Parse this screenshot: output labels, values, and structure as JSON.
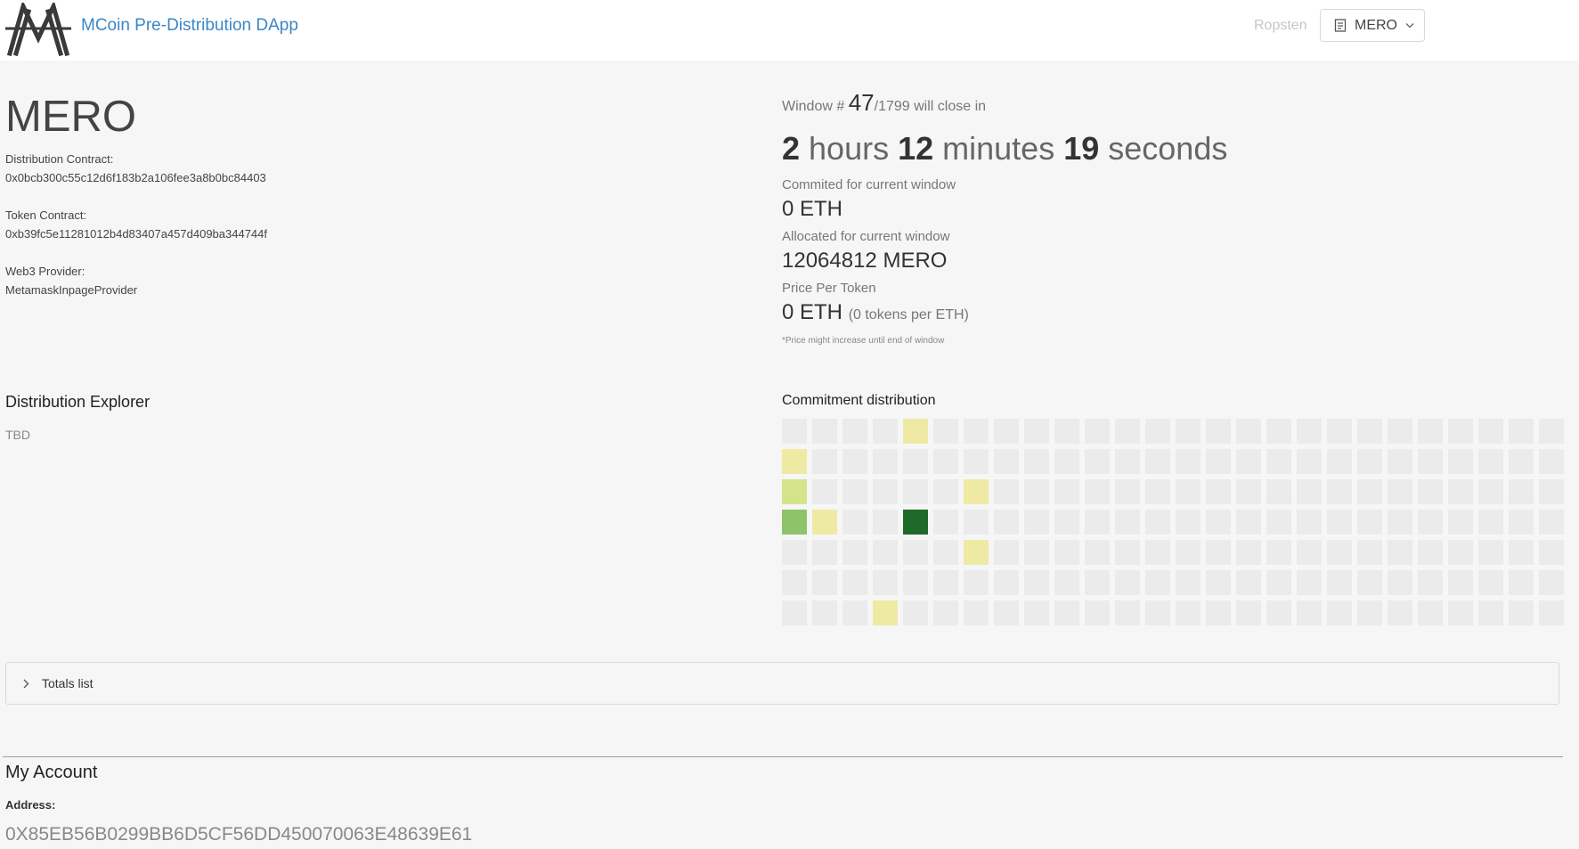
{
  "header": {
    "app_title": "MCoin Pre-Distribution DApp",
    "network": "Ropsten",
    "token_select": {
      "value": "MERO",
      "icon": "document-icon",
      "chevron_icon": "chevron-down-icon"
    },
    "logo_icon": "mcoin-logo-icon"
  },
  "token": {
    "name": "MERO",
    "distribution_contract_label": "Distribution Contract:",
    "distribution_contract": "0x0bcb300c55c12d6f183b2a106fee3a8b0bc84403",
    "token_contract_label": "Token Contract:",
    "token_contract": "0xb39fc5e11281012b4d83407a457d409ba344744f",
    "web3_provider_label": "Web3 Provider:",
    "web3_provider": "MetamaskInpageProvider"
  },
  "window": {
    "prefix": "Window # ",
    "current": "47",
    "total": "/1799",
    "suffix": " will close in",
    "countdown": {
      "hours": "2",
      "hours_label": " hours ",
      "minutes": "12",
      "minutes_label": " minutes ",
      "seconds": "19",
      "seconds_label": " seconds"
    },
    "committed_label": "Commited for current window",
    "committed_value": "0 ETH",
    "allocated_label": "Allocated for current window",
    "allocated_value": "12064812 MERO",
    "price_label": "Price Per Token",
    "price_value": "0 ETH",
    "price_rate": "(0 tokens per ETH)",
    "price_note": "*Price might increase until end of window"
  },
  "explorer": {
    "title": "Distribution Explorer",
    "content": "TBD"
  },
  "commitment": {
    "title": "Commitment distribution",
    "rows": 7,
    "cols": 26,
    "base_color": "#ebebeb",
    "highlighted": [
      {
        "row": 0,
        "col": 4,
        "color": "#eeeaa3"
      },
      {
        "row": 1,
        "col": 0,
        "color": "#eeeaa3"
      },
      {
        "row": 2,
        "col": 0,
        "color": "#d5e38a"
      },
      {
        "row": 2,
        "col": 6,
        "color": "#eeeaa3"
      },
      {
        "row": 3,
        "col": 0,
        "color": "#8fc36a"
      },
      {
        "row": 3,
        "col": 1,
        "color": "#eeeaa3"
      },
      {
        "row": 3,
        "col": 4,
        "color": "#1f6a28"
      },
      {
        "row": 4,
        "col": 6,
        "color": "#eeeaa3"
      },
      {
        "row": 6,
        "col": 3,
        "color": "#eeeaa3"
      }
    ]
  },
  "totals": {
    "label": "Totals list",
    "icon": "chevron-right-icon"
  },
  "account": {
    "title": "My Account",
    "address_label": "Address:",
    "address": "0X85EB56B0299BB6D5CF56DD450070063E48639E61"
  }
}
